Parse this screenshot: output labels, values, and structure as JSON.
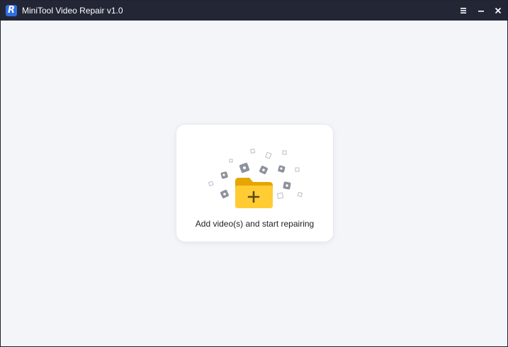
{
  "window": {
    "title": "MiniTool Video Repair v1.0",
    "logo_letter": "R",
    "controls": {
      "menu_icon": "hamburger-menu-icon",
      "minimize_icon": "minimize-icon",
      "close_icon": "close-icon"
    }
  },
  "main": {
    "drop_zone": {
      "label": "Add video(s) and start repairing",
      "icon": "add-folder-icon"
    }
  },
  "colors": {
    "titlebar": "#232635",
    "background": "#f4f5f8",
    "folder": "#ffcc33",
    "logo": "#2f6fe0"
  }
}
